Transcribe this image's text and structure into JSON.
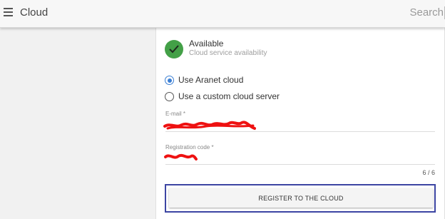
{
  "header": {
    "title": "Cloud",
    "search_placeholder": "Search",
    "menu_icon": "hamburger-menu-icon"
  },
  "status": {
    "icon": "check-icon",
    "color": "#43a047",
    "title": "Available",
    "subtitle": "Cloud service availability"
  },
  "cloud_options": [
    {
      "label": "Use Aranet cloud",
      "selected": true
    },
    {
      "label": "Use a custom cloud server",
      "selected": false
    }
  ],
  "form": {
    "email_label": "E-mail *",
    "registration_label": "Registration code *",
    "registration_counter": "6 / 6",
    "redaction_color": "#ee1111"
  },
  "actions": {
    "register_label": "REGISTER TO THE CLOUD",
    "highlight_color": "#3c45a3"
  }
}
